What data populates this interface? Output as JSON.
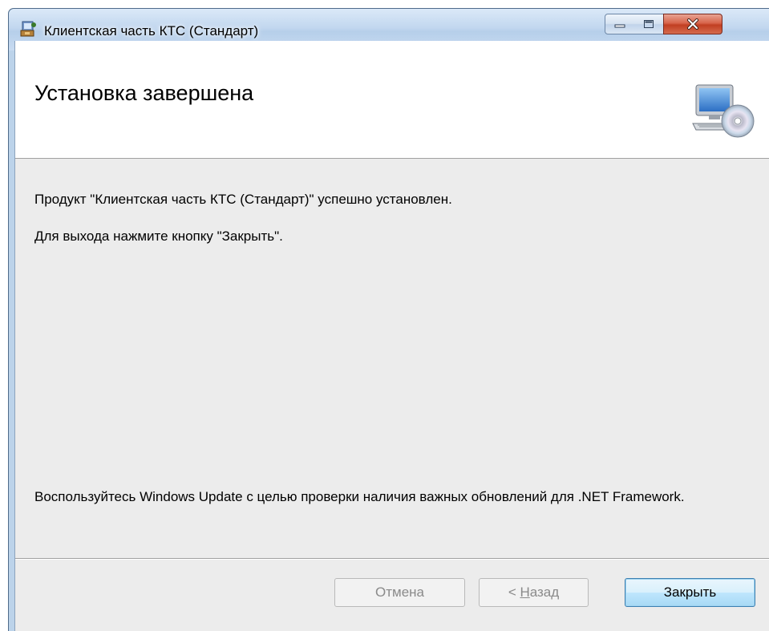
{
  "window": {
    "title": "Клиентская часть КТС (Стандарт)",
    "icons": {
      "app": "installer-icon",
      "minimize": "minimize-icon",
      "maximize": "maximize-icon",
      "close": "close-icon"
    }
  },
  "banner": {
    "title": "Установка завершена",
    "icon": "computer-cd-icon"
  },
  "body": {
    "line1": "Продукт \"Клиентская часть КТС (Стандарт)\" успешно установлен.",
    "line2": "Для выхода нажмите кнопку \"Закрыть\".",
    "line3": "Воспользуйтесь Windows Update с целью проверки наличия важных обновлений для .NET Framework."
  },
  "buttons": {
    "cancel": "Отмена",
    "back_prefix": "< ",
    "back_accel": "Н",
    "back_rest": "азад",
    "close": "Закрыть"
  },
  "colors": {
    "accent_close_button": "#c13f22",
    "default_button_border": "#3c7fb1",
    "dialog_background": "#ececec"
  }
}
